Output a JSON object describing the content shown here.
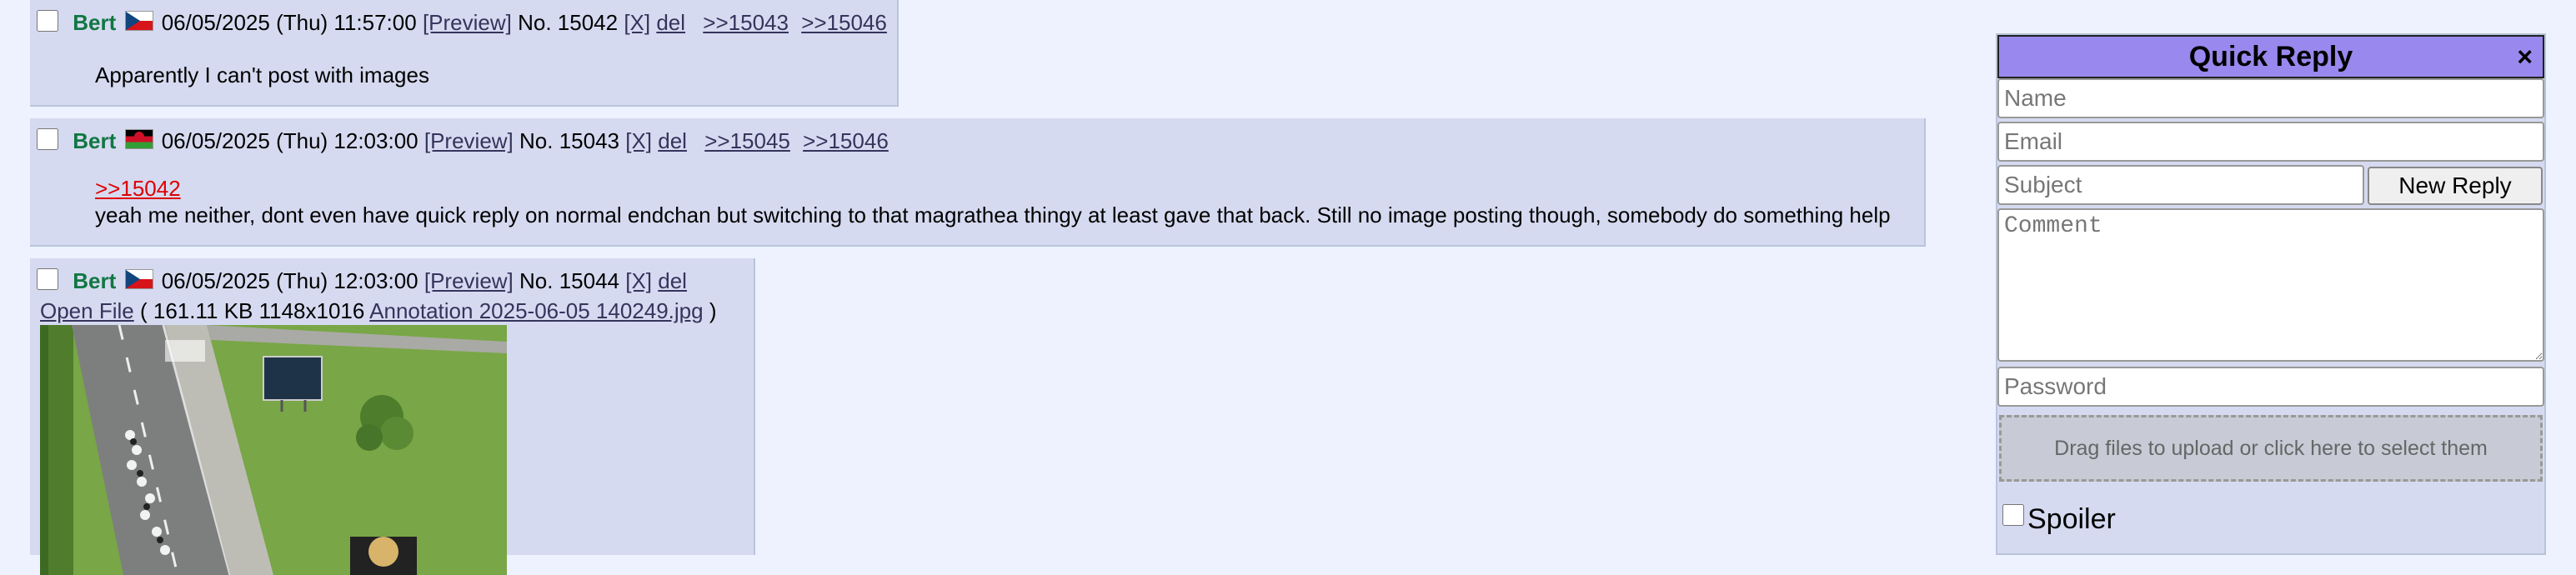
{
  "posts": [
    {
      "name": "Bert",
      "flag": "cz-flag-icon",
      "date": "06/05/2025 (Thu) 11:57:00",
      "preview_label": "[Preview]",
      "number_label": "No. 15042",
      "x_label": "[X]",
      "del_label": "del",
      "backlinks": [
        ">>15043",
        ">>15046"
      ],
      "message": "Apparently I can't post with images"
    },
    {
      "name": "Bert",
      "flag": "mw-flag-icon",
      "date": "06/05/2025 (Thu) 12:03:00",
      "preview_label": "[Preview]",
      "number_label": "No. 15043",
      "x_label": "[X]",
      "del_label": "del",
      "backlinks": [
        ">>15045",
        ">>15046"
      ],
      "quote": ">>15042",
      "message": "yeah me neither, dont even have quick reply on normal endchan but switching to that magrathea thingy at least gave that back. Still no image posting though, somebody do something help"
    },
    {
      "name": "Bert",
      "flag": "cz-flag-icon",
      "date": "06/05/2025 (Thu) 12:03:00",
      "preview_label": "[Preview]",
      "number_label": "No. 15044",
      "x_label": "[X]",
      "del_label": "del",
      "file": {
        "open_label": "Open File",
        "open_paren": "(",
        "size_dims": "161.11 KB 1148x1016",
        "filename": "Annotation 2025-06-05 140249.jpg",
        "close_paren": ")"
      }
    }
  ],
  "quick_reply": {
    "title": "Quick Reply",
    "close_symbol": "×",
    "name_placeholder": "Name",
    "email_placeholder": "Email",
    "subject_placeholder": "Subject",
    "new_reply_label": "New Reply",
    "comment_placeholder": "Comment",
    "password_placeholder": "Password",
    "drop_label": "Drag files to upload or click here to select them",
    "spoiler_label": "Spoiler"
  },
  "colors": {
    "page_bg": "#eef2ff",
    "post_bg": "#d6daf0",
    "name": "#117743",
    "quote_link": "#dd0000",
    "qr_header": "#9988ee"
  }
}
